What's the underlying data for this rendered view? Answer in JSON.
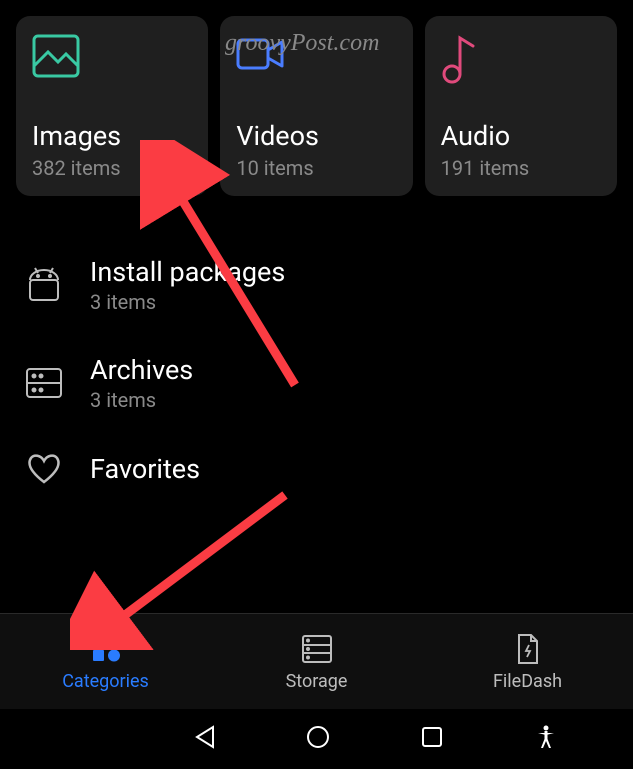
{
  "watermark": "groovyPost.com",
  "cards": [
    {
      "title": "Images",
      "sub": "382 items"
    },
    {
      "title": "Videos",
      "sub": "10 items"
    },
    {
      "title": "Audio",
      "sub": "191 items"
    }
  ],
  "list": [
    {
      "title": "Install packages",
      "sub": "3 items"
    },
    {
      "title": "Archives",
      "sub": "3 items"
    },
    {
      "title": "Favorites",
      "sub": ""
    }
  ],
  "nav": {
    "categories": "Categories",
    "storage": "Storage",
    "filedash": "FileDash"
  },
  "colors": {
    "image_icon": "#39c9a3",
    "video_icon": "#4a7dff",
    "audio_icon": "#e04a7c",
    "active_nav": "#2a7cff",
    "arrow": "#fb3c43"
  }
}
